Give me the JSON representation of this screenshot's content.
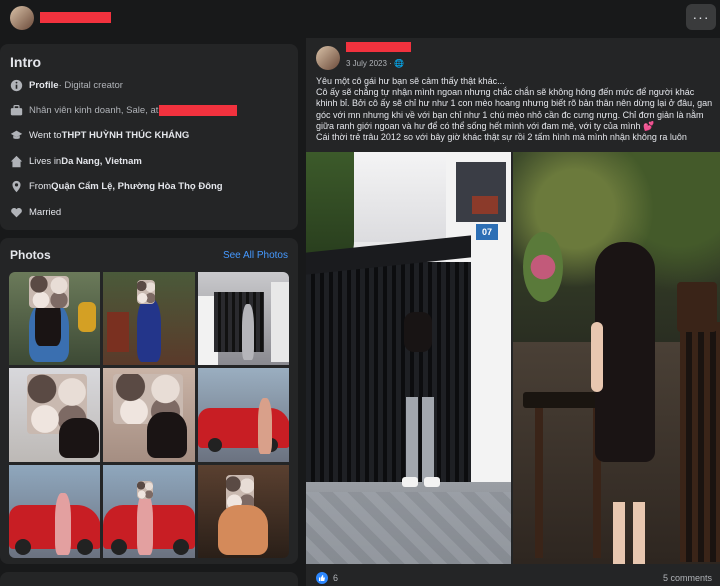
{
  "header": {
    "more_label": "···"
  },
  "intro": {
    "title": "Intro",
    "rows": [
      {
        "icon": "info-icon",
        "strong": "Profile",
        "text": " · Digital creator"
      },
      {
        "icon": "briefcase-icon",
        "strong": "",
        "text": "Nhân viên kinh doanh, Sale, at "
      },
      {
        "icon": "graduation-cap-icon",
        "prefix": "Went to ",
        "strong": "THPT HUỲNH THÚC KHÁNG"
      },
      {
        "icon": "home-icon",
        "prefix": "Lives in ",
        "strong": "Da Nang, Vietnam"
      },
      {
        "icon": "location-pin-icon",
        "prefix": "From ",
        "strong": "Quận Cẩm Lệ, Phường Hòa Thọ Đông"
      },
      {
        "icon": "heart-icon",
        "strong": "",
        "text": "Married"
      }
    ]
  },
  "photos": {
    "title": "Photos",
    "see_all": "See All Photos"
  },
  "post": {
    "date": "3 July 2023 · 🌐",
    "lines": [
      "Yêu một cô gái hư bạn sẽ cảm thấy thật khác...",
      "Cô ấy sẽ chẳng tự nhận mình ngoan nhưng chắc chắn sẽ không hông đến mức để người khác khinh bỉ. Bởi cô ấy sẽ chỉ hư như 1 con mèo hoang nhưng biết rõ bản thân nên dừng lại ở đâu, gan góc với mn nhưng khi về với bạn chỉ như 1 chú mèo nhỏ cần đc cưng nựng. Chỉ đơn giản là nằm giữa ranh giới ngoan và hư để có thể sống hết mình với đam mê, với ty của mình",
      "Cái thời trẻ trâu 2012 so với bây giờ khác thật sự rồi 2 tấm hình mà mình nhận không ra luôn"
    ],
    "heart_emoji": "💕",
    "gate_number": "07",
    "like_count": "6",
    "comments": "5 comments"
  }
}
